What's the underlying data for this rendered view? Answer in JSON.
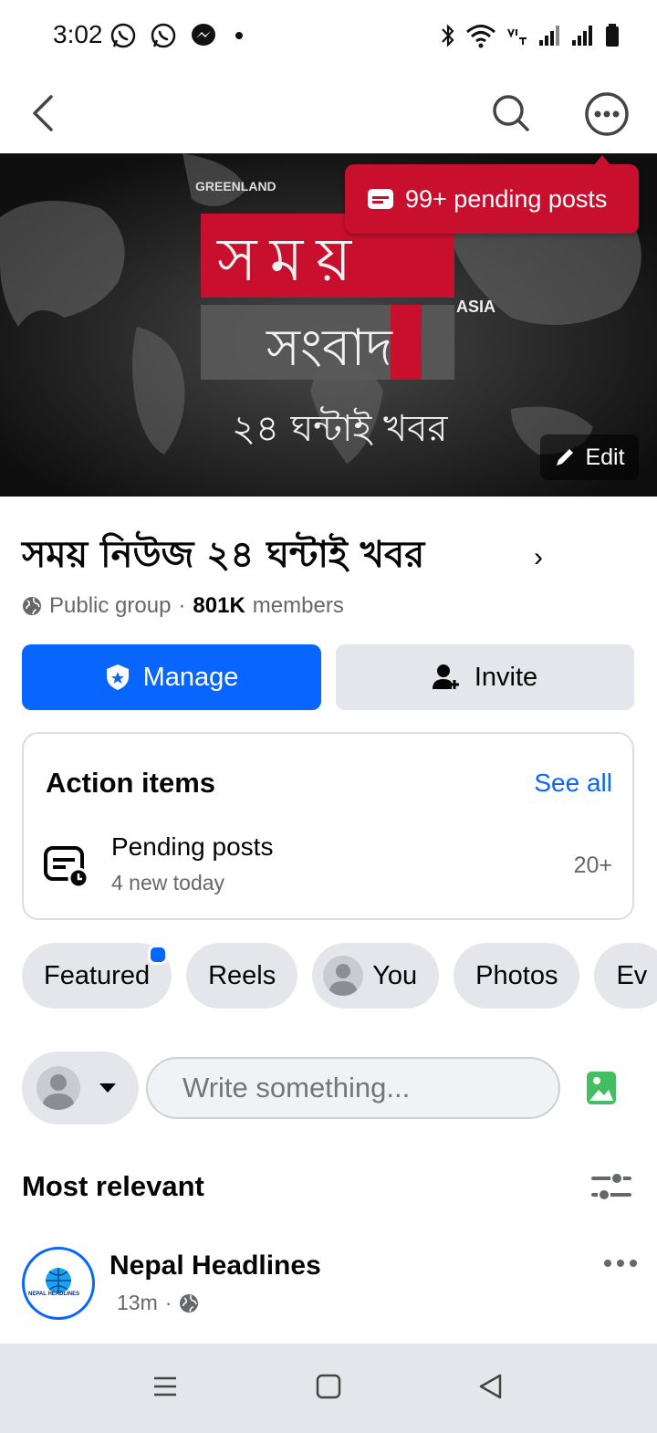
{
  "status_bar": {
    "time": "3:02"
  },
  "header": {
    "pending_badge": "99+ pending posts",
    "edit_label": "Edit"
  },
  "group": {
    "title": "সময় নিউজ ২৪ ঘন্টাই খবর",
    "privacy": "Public group",
    "separator": "·",
    "member_count": "801K",
    "members_word": "members"
  },
  "buttons": {
    "manage": "Manage",
    "invite": "Invite"
  },
  "action_items": {
    "title": "Action items",
    "see_all": "See all",
    "item_label": "Pending posts",
    "item_sub": "4 new today",
    "item_count": "20+"
  },
  "chips": [
    "Featured",
    "Reels",
    "You",
    "Photos",
    "Ev"
  ],
  "composer": {
    "placeholder": "Write something..."
  },
  "feed": {
    "sort_label": "Most relevant",
    "post": {
      "author": "Nepal Headlines",
      "time": "13m",
      "separator": "·",
      "logo_text": "NEPAL HEADLINES"
    }
  },
  "cover_text": {
    "line1": "সময়",
    "line2": "সংবাদ",
    "line3": "২৪ ঘন্টাই খবর",
    "asia": "ASIA",
    "greenland": "GREENLAND"
  },
  "colors": {
    "accent": "#0866ff",
    "badge": "#c8102e",
    "chip_bg": "#e4e6eb"
  }
}
